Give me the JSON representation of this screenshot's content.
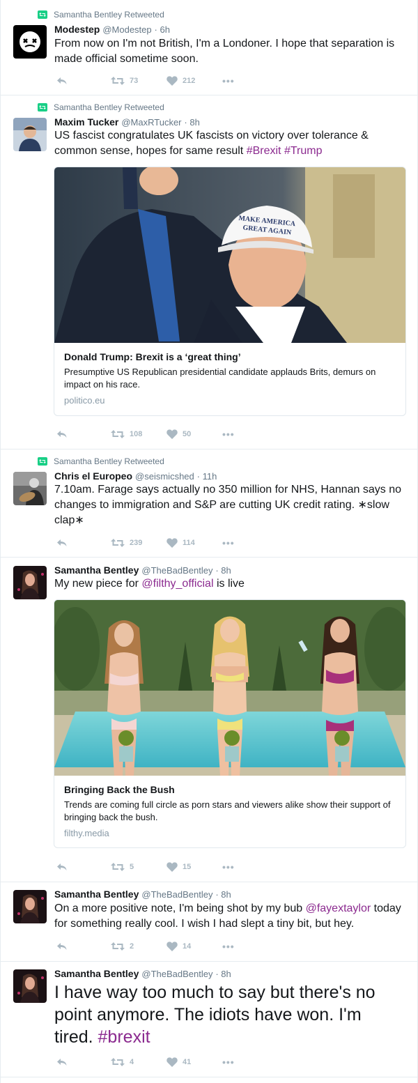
{
  "colors": {
    "accent": "#8b2a8f",
    "retweet_green": "#19cf86",
    "muted": "#657786",
    "icon": "#aab8c2",
    "border": "#e6ecf0"
  },
  "tweets": [
    {
      "retweeted_by": "Samantha Bentley Retweeted",
      "name": "Modestep",
      "handle": "@Modestep",
      "time": "· 6h",
      "text": "From now on I'm not British, I'm a Londoner. I hope that separation is made official sometime soon.",
      "retweets": "73",
      "likes": "212"
    },
    {
      "retweeted_by": "Samantha Bentley Retweeted",
      "name": "Maxim Tucker",
      "handle": "@MaxRTucker",
      "time": "· 8h",
      "text_before": "US fascist congratulates UK fascists on victory over tolerance & common sense, hopes for same result ",
      "hashtag1": "#Brexit",
      "hashtag2": "#Trump",
      "card": {
        "cap_text_1": "MAKE AMERICA",
        "cap_text_2": "GREAT AGAIN",
        "title": "Donald Trump: Brexit is a ‘great thing’",
        "description": "Presumptive US Republican presidential candidate applauds Brits, demurs on impact on his race.",
        "domain": "politico.eu"
      },
      "retweets": "108",
      "likes": "50"
    },
    {
      "retweeted_by": "Samantha Bentley Retweeted",
      "name": "Chris el Europeo",
      "handle": "@seismicshed",
      "time": "· 11h",
      "text": "7.10am. Farage says actually no 350 million for NHS, Hannan says no changes to immigration and S&P are cutting UK credit rating. ∗slow clap∗",
      "retweets": "239",
      "likes": "114"
    },
    {
      "name": "Samantha Bentley",
      "handle": "@TheBadBentley",
      "time": "· 8h",
      "text_before": "My new piece for ",
      "mention": "@filthy_official",
      "text_after": " is live",
      "card": {
        "title": "Bringing Back the Bush",
        "description": "Trends are coming full circle as porn stars and viewers alike show their support of bringing back the bush.",
        "domain": "filthy.media"
      },
      "retweets": "5",
      "likes": "15"
    },
    {
      "name": "Samantha Bentley",
      "handle": "@TheBadBentley",
      "time": "· 8h",
      "text_before": "On a more positive note, I'm being shot by my bub ",
      "mention": "@fayextaylor",
      "text_after": " today for something really cool. I wish I had slept a tiny bit, but hey.",
      "retweets": "2",
      "likes": "14"
    },
    {
      "name": "Samantha Bentley",
      "handle": "@TheBadBentley",
      "time": "· 8h",
      "text_before": "I have way too much to say but there's no point anymore. The idiots have won. I'm tired. ",
      "hashtag": "#brexit",
      "retweets": "4",
      "likes": "41"
    }
  ]
}
